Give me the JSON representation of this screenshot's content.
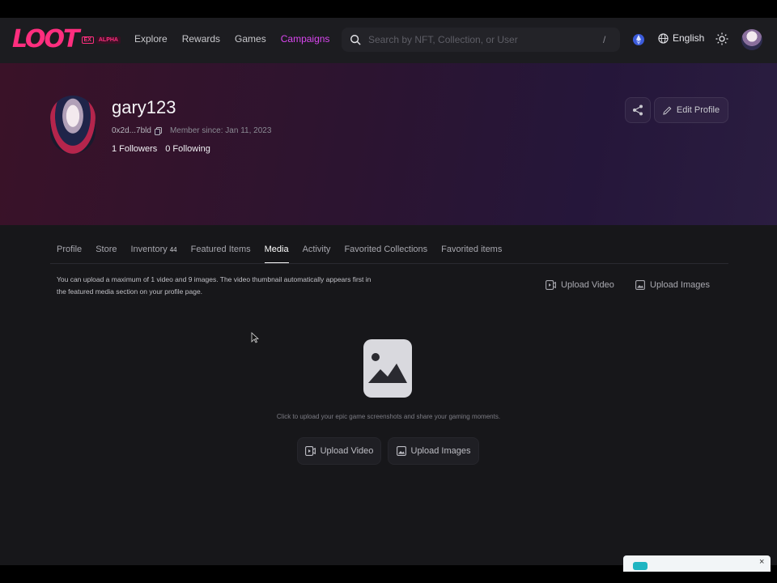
{
  "nav": {
    "logo": "LOOT",
    "badge_ex": "EX",
    "badge_alpha": "ALPHA",
    "links": [
      "Explore",
      "Rewards",
      "Games",
      "Campaigns"
    ],
    "active_link": "Campaigns",
    "search_placeholder": "Search by NFT, Collection, or User",
    "search_shortcut": "/",
    "language": "English",
    "accent_color": "#d946ef",
    "brand_color": "#ff2e7e"
  },
  "profile": {
    "username": "gary123",
    "address": "0x2d...7bld",
    "member_since": "Member since: Jan 11, 2023",
    "followers": "1 Followers",
    "following": "0 Following",
    "edit_label": "Edit Profile"
  },
  "tabs": [
    {
      "label": "Profile"
    },
    {
      "label": "Store"
    },
    {
      "label": "Inventory",
      "count": "44"
    },
    {
      "label": "Featured Items"
    },
    {
      "label": "Media",
      "active": true
    },
    {
      "label": "Activity"
    },
    {
      "label": "Favorited Collections"
    },
    {
      "label": "Favorited items"
    }
  ],
  "media": {
    "note": "You can upload a maximum of 1 video and 9 images. The video thumbnail automatically appears first in the featured media section on your profile page.",
    "upload_video": "Upload Video",
    "upload_images": "Upload Images",
    "empty_message": "Click to upload your epic game screenshots and share your gaming moments."
  },
  "toast": {
    "close": "×"
  }
}
